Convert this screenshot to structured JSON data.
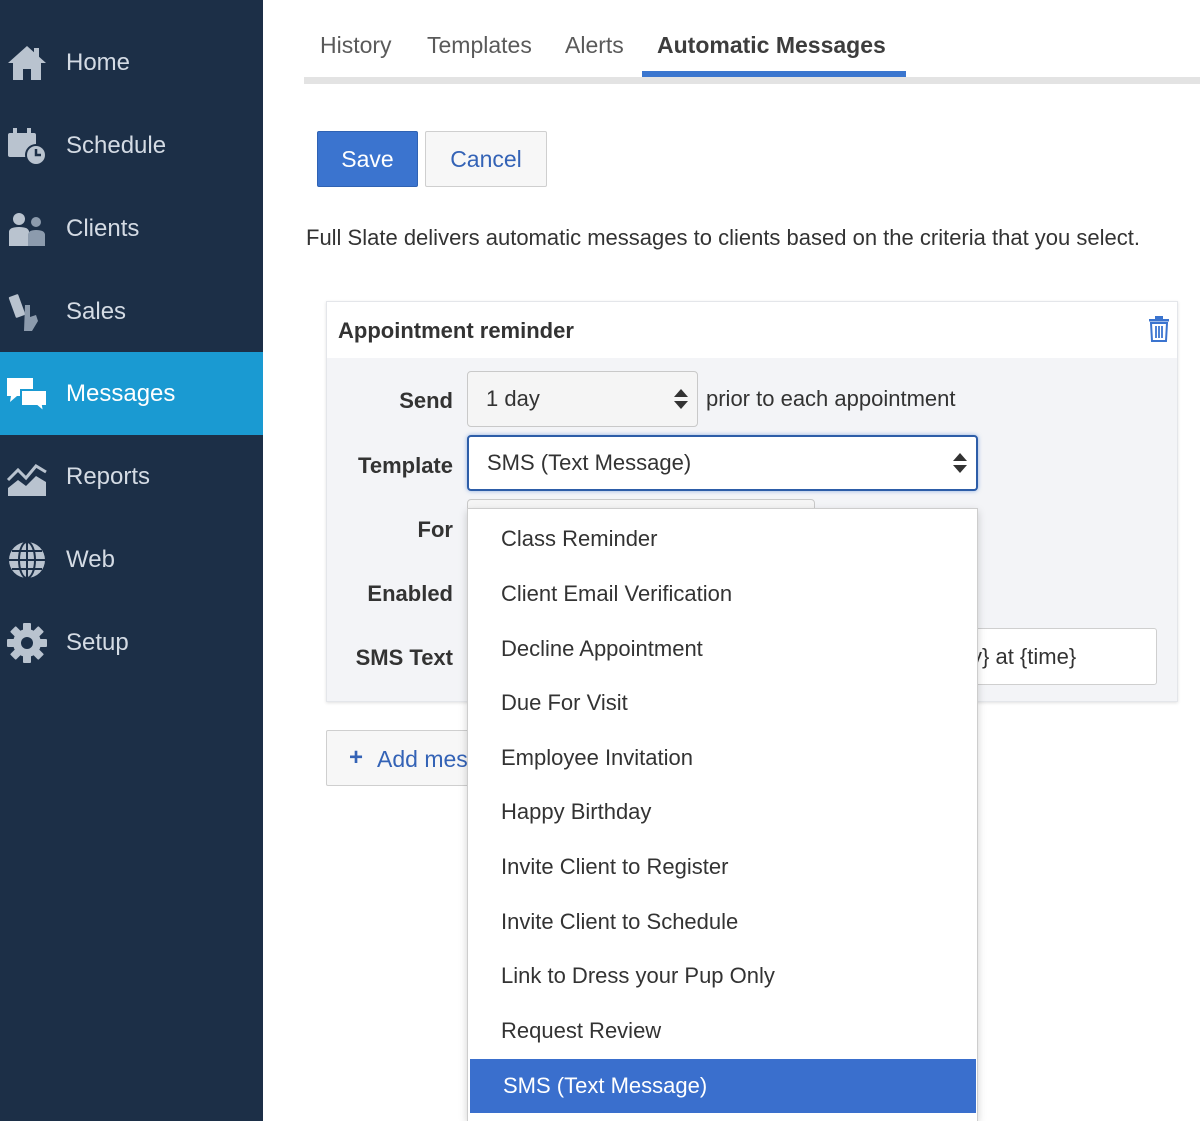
{
  "sidebar": {
    "items": [
      {
        "label": "Home",
        "icon": "home-icon"
      },
      {
        "label": "Schedule",
        "icon": "schedule-icon"
      },
      {
        "label": "Clients",
        "icon": "clients-icon"
      },
      {
        "label": "Sales",
        "icon": "sales-icon"
      },
      {
        "label": "Messages",
        "icon": "messages-icon",
        "active": true
      },
      {
        "label": "Reports",
        "icon": "reports-icon"
      },
      {
        "label": "Web",
        "icon": "globe-icon"
      },
      {
        "label": "Setup",
        "icon": "gear-icon"
      }
    ]
  },
  "tabs": [
    {
      "label": "History"
    },
    {
      "label": "Templates"
    },
    {
      "label": "Alerts"
    },
    {
      "label": "Automatic Messages",
      "active": true
    }
  ],
  "toolbar": {
    "save_label": "Save",
    "cancel_label": "Cancel"
  },
  "description": "Full Slate delivers automatic messages to clients based on the criteria that you select.",
  "card": {
    "title": "Appointment reminder",
    "send_label": "Send",
    "send_value": "1 day",
    "send_suffix": "prior to each appointment",
    "template_label": "Template",
    "template_value": "SMS (Text Message)",
    "for_label": "For",
    "enabled_label": "Enabled",
    "sms_label": "SMS Text",
    "sms_value_visible": "y} at {time}"
  },
  "add_button": {
    "plus": "+",
    "label": "Add mes"
  },
  "dropdown": {
    "options": [
      "Class Reminder",
      "Client Email Verification",
      "Decline Appointment",
      "Due For Visit",
      "Employee Invitation",
      "Happy Birthday",
      "Invite Client to Register",
      "Invite Client to Schedule",
      "Link to Dress your Pup Only",
      "Request Review",
      "SMS (Text Message)"
    ],
    "selected": "SMS (Text Message)"
  },
  "colors": {
    "sidebar": "#1c2f47",
    "sidebar_active": "#1a9ad2",
    "primary": "#3b74cf",
    "selected_option": "#3a6fcd"
  }
}
